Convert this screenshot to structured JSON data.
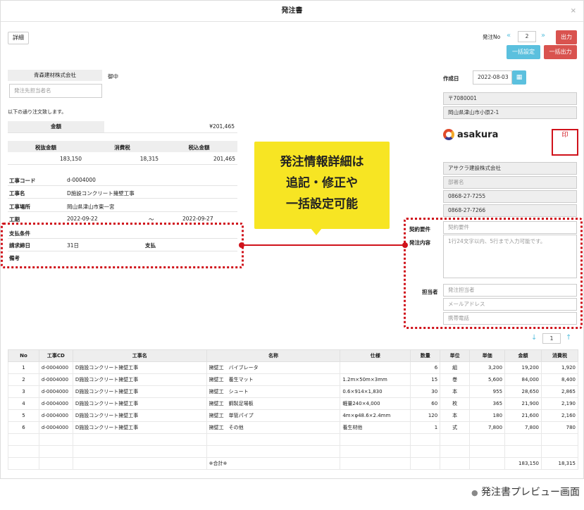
{
  "window": {
    "title": "発注書"
  },
  "toolbar": {
    "detail_label": "詳細",
    "order_no_label": "発注No",
    "prev_icon": "«",
    "next_icon": "»",
    "order_no_value": "2",
    "output_label": "出力",
    "bulk_settings_label": "一括設定",
    "bulk_output_label": "一括出力"
  },
  "recipient": {
    "company": "青森建材株式会社",
    "honorific": "御中",
    "contact_placeholder": "発注先担当者名",
    "intro": "以下の通り注文致します。"
  },
  "amount": {
    "label": "金額",
    "value": "¥201,465",
    "headers": [
      "税抜金額",
      "消費税",
      "税込金額"
    ],
    "values": [
      "183,150",
      "18,315",
      "201,465"
    ]
  },
  "project": {
    "code_label": "工事コード",
    "code": "d-0004000",
    "name_label": "工事名",
    "name": "D施設コンクリート擁壁工事",
    "site_label": "工事場所",
    "site": "岡山県津山市東一宮",
    "period_label": "工期",
    "start": "2022-09-22",
    "tilde": "〜",
    "end": "2022-09-27",
    "payment_label": "支払条件",
    "closing_label": "請求締日",
    "closing": "31日",
    "pay_label": "支払",
    "notes_label": "備考"
  },
  "issuer": {
    "date_label": "作成日",
    "date": "2022-08-03",
    "postal": "〒7080001",
    "address": "岡山県津山市小原2-1",
    "logo_text": "asakura",
    "seal_text": "アサクラ建設株式会社",
    "company": "アサクラ建設株式会社",
    "dept_placeholder": "部署名",
    "tel": "0868-27-7255",
    "fax": "0868-27-7266"
  },
  "conditions": {
    "contract_label": "契約要件",
    "contract_placeholder": "契約要件",
    "content_label": "発注内容",
    "content_placeholder": "1行24文字以内、5行まで入力可能です。",
    "person_label": "担当者",
    "person_placeholder": "発注担当者",
    "email_placeholder": "メールアドレス",
    "mobile_placeholder": "携帯電話"
  },
  "pager": {
    "down_icon": "↓",
    "page": "1",
    "up_icon": "↑"
  },
  "callout": {
    "line1": "発注情報詳細は",
    "line2": "追記・修正や",
    "line3": "一括設定可能"
  },
  "table": {
    "headers": [
      "No",
      "工事CD",
      "工事名",
      "名称",
      "仕様",
      "数量",
      "単位",
      "単価",
      "金額",
      "消費税"
    ],
    "rows": [
      [
        "1",
        "d-0004000",
        "D施設コンクリート擁壁工事",
        "擁壁工　バイブレータ",
        "",
        "6",
        "組",
        "3,200",
        "19,200",
        "1,920"
      ],
      [
        "2",
        "d-0004000",
        "D施設コンクリート擁壁工事",
        "擁壁工　養生マット",
        "1.2m×50m×3mm",
        "15",
        "巻",
        "5,600",
        "84,000",
        "8,400"
      ],
      [
        "3",
        "d-0004000",
        "D施設コンクリート擁壁工事",
        "擁壁工　シュート",
        "0.6×914×1,830",
        "30",
        "本",
        "955",
        "28,650",
        "2,865"
      ],
      [
        "4",
        "d-0004000",
        "D施設コンクリート擁壁工事",
        "擁壁工　鋼製足場板",
        "軽量240×4,000",
        "60",
        "枚",
        "365",
        "21,900",
        "2,190"
      ],
      [
        "5",
        "d-0004000",
        "D施設コンクリート擁壁工事",
        "擁壁工　単管パイプ",
        "4m×φ48.6×2.4mm",
        "120",
        "本",
        "180",
        "21,600",
        "2,160"
      ],
      [
        "6",
        "d-0004000",
        "D施設コンクリート擁壁工事",
        "擁壁工　その他",
        "養生材他",
        "1",
        "式",
        "7,800",
        "7,800",
        "780"
      ]
    ],
    "total_label": "※合計※",
    "total_amount": "183,150",
    "total_tax": "18,315"
  },
  "caption": {
    "bullet": "●",
    "text": "発注書プレビュー画面"
  }
}
